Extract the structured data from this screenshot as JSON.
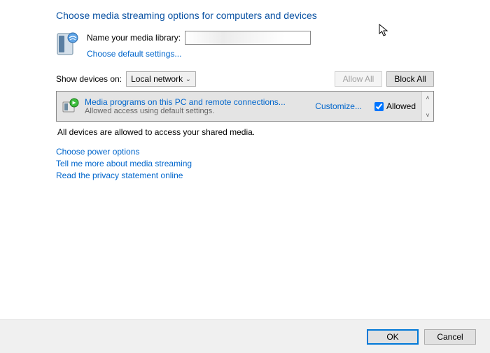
{
  "title": "Choose media streaming options for computers and devices",
  "name_label": "Name your media library:",
  "name_value": "",
  "choose_defaults": "Choose default settings...",
  "show_label": "Show devices on:",
  "show_value": "Local network",
  "allow_all": "Allow All",
  "block_all": "Block All",
  "device": {
    "title": "Media programs on this PC and remote connections...",
    "subtitle": "Allowed access using default settings.",
    "customize": "Customize...",
    "allowed_label": "Allowed"
  },
  "status": "All devices are allowed to access your shared media.",
  "links": {
    "power": "Choose power options",
    "more": "Tell me more about media streaming",
    "privacy": "Read the privacy statement online"
  },
  "footer": {
    "ok": "OK",
    "cancel": "Cancel"
  }
}
